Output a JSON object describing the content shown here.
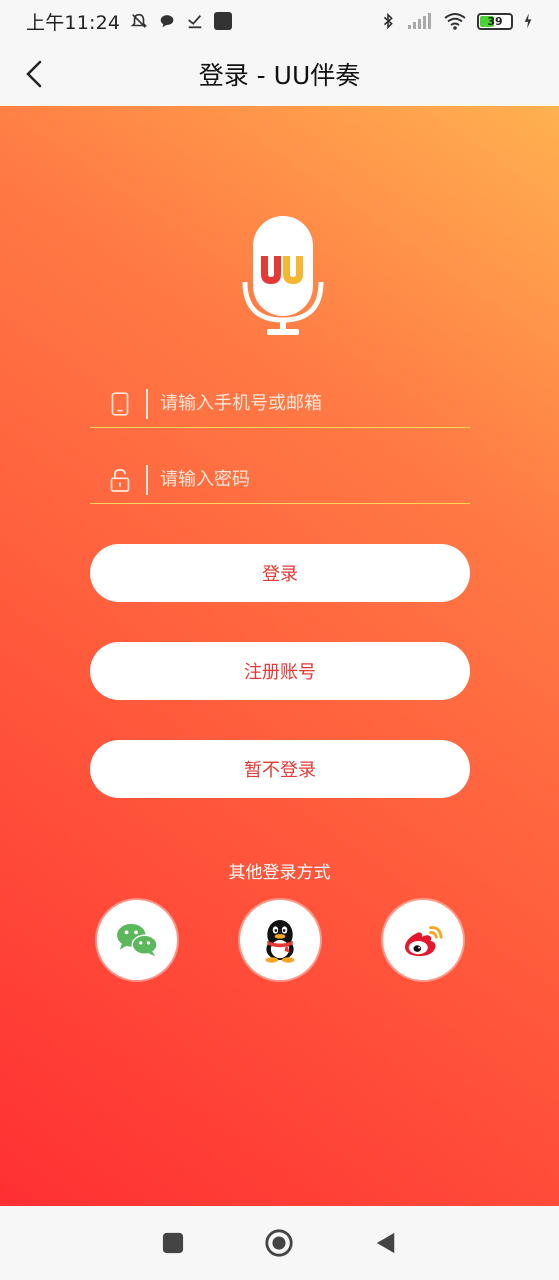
{
  "status_bar": {
    "time": "上午11:24",
    "battery": "39"
  },
  "app_bar": {
    "title": "登录 - UU伴奏"
  },
  "logo": {
    "text": "UU"
  },
  "form": {
    "account_placeholder": "请输入手机号或邮箱",
    "password_placeholder": "请输入密码"
  },
  "buttons": {
    "login": "登录",
    "register": "注册账号",
    "skip": "暂不登录"
  },
  "other_login": {
    "label": "其他登录方式",
    "providers": [
      "wechat",
      "qq",
      "weibo"
    ]
  },
  "colors": {
    "gradient_start": "#ff2f33",
    "gradient_end": "#ffb150",
    "button_text": "#e53935",
    "underline": "#f7d65a"
  }
}
